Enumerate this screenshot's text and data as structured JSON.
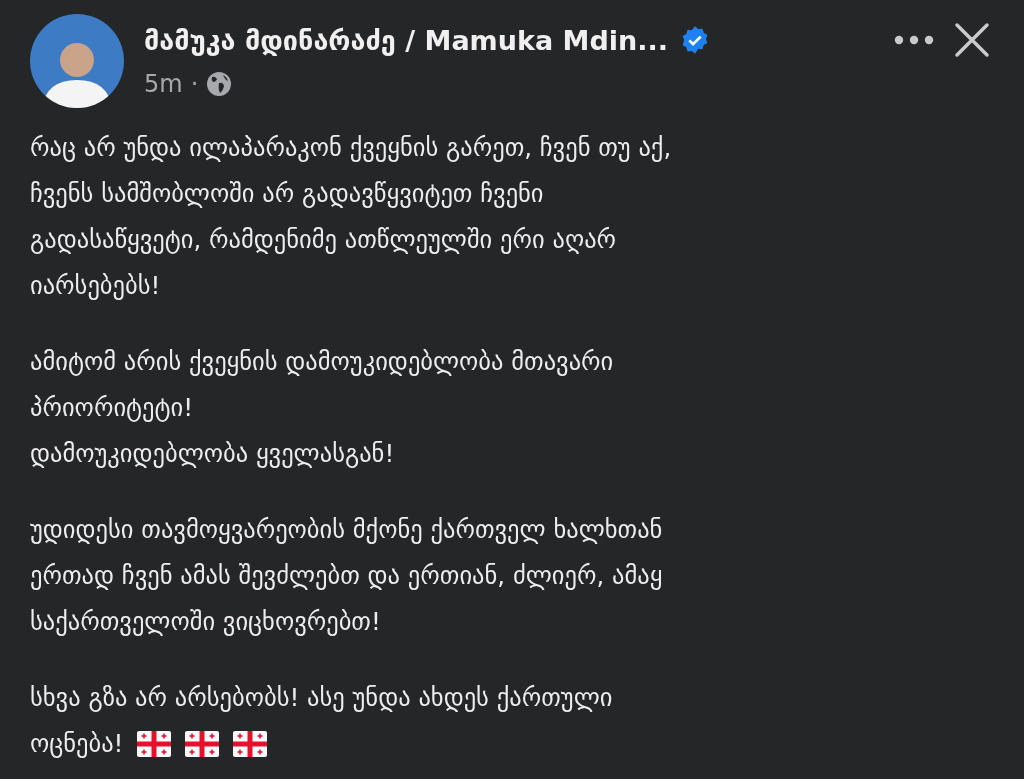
{
  "post": {
    "author": "მამუკა მდინარაძე / Mamuka Mdin...",
    "verified": true,
    "time": "5m",
    "separator": "·",
    "paragraphs": [
      {
        "lines": [
          "რაც არ უნდა ილაპარაკონ ქვეყნის გარეთ, ჩვენ თუ აქ,",
          "ჩვენს სამშობლოში არ გადავწყვიტეთ ჩვენი",
          "გადასაწყვეტი, რამდენიმე ათწლეულში ერი აღარ",
          "იარსებებს!"
        ]
      },
      {
        "lines": [
          "ამიტომ არის ქვეყნის დამოუკიდებლობა მთავარი",
          "პრიორიტეტი!",
          "დამოუკიდებლობა ყველასგან!"
        ]
      },
      {
        "lines": [
          "უდიდესი თავმოყვარეობის მქონე ქართველ ხალხთან",
          "ერთად ჩვენ ამას შევძლებთ და ერთიან, ძლიერ, ამაყ",
          "საქართველოში ვიცხოვრებთ!"
        ]
      },
      {
        "lines": [
          "სხვა გზა არ არსებობს! ასე უნდა ახდეს ქართული",
          "ოცნება!"
        ],
        "emoji": [
          {
            "kind": "flag"
          },
          {
            "kind": "flag"
          },
          {
            "kind": "flag"
          }
        ]
      }
    ]
  }
}
